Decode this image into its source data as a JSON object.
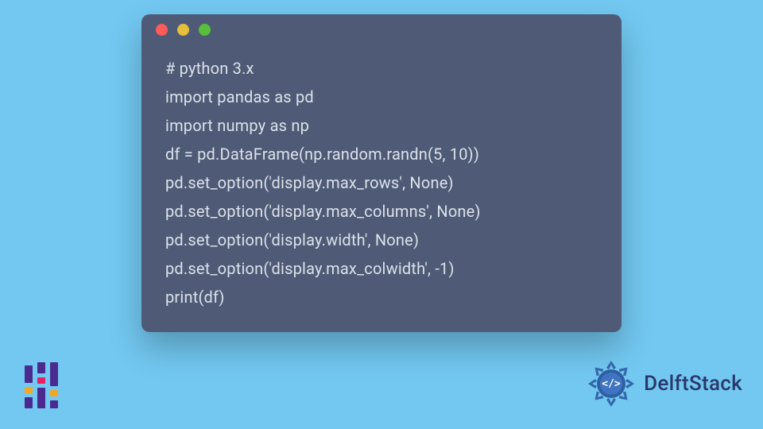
{
  "window": {
    "dots": [
      "red",
      "yellow",
      "green"
    ]
  },
  "code": {
    "lines": [
      "# python 3.x",
      "import pandas as pd",
      "import numpy as np",
      "df = pd.DataFrame(np.random.randn(5, 10))",
      "pd.set_option('display.max_rows', None)",
      "pd.set_option('display.max_columns', None)",
      "pd.set_option('display.width', None)",
      "pd.set_option('display.max_colwidth', -1)",
      "print(df)"
    ]
  },
  "brand": {
    "name": "DelftStack"
  }
}
